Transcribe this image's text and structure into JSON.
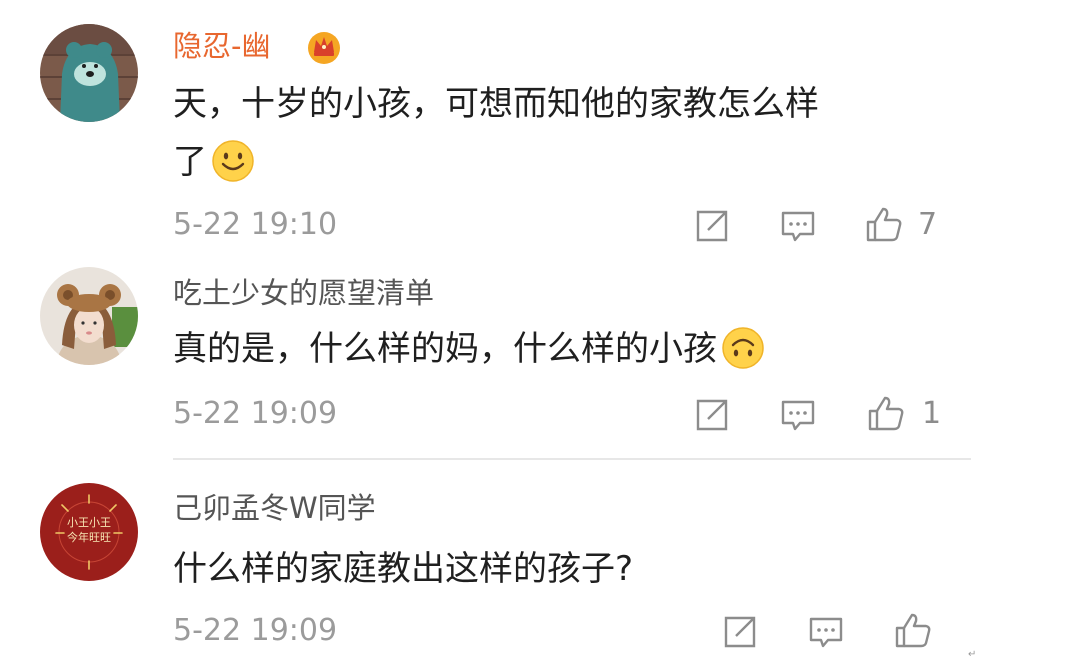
{
  "comments": [
    {
      "username": "隐忍-幽",
      "vip_badge": "crown-vip-icon",
      "text_line1": "天，十岁的小孩，可想而知他的家教怎么样",
      "text_line2": "了",
      "emoji": "smile-emoji",
      "time": "5-22 19:10",
      "like_count": "7"
    },
    {
      "username": "吃土少女的愿望清单",
      "text_line1": "真的是，什么样的妈，什么样的小孩",
      "emoji": "upside-down-face-emoji",
      "time": "5-22 19:09",
      "like_count": "1"
    },
    {
      "username": "己卯孟冬W同学",
      "text_line1": "什么样的家庭教出这样的孩子?",
      "avatar_text_line1": "小王小王",
      "avatar_text_line2": "今年旺旺",
      "time": "5-22 19:09",
      "like_count": ""
    }
  ],
  "corner_mark": "↵",
  "colors": {
    "vip_name": "#e8672f",
    "normal_name": "#555555",
    "text": "#1f1f1f",
    "time": "#9b9b9b",
    "icon": "#8c8c8c",
    "divider": "#e7e7e7"
  }
}
